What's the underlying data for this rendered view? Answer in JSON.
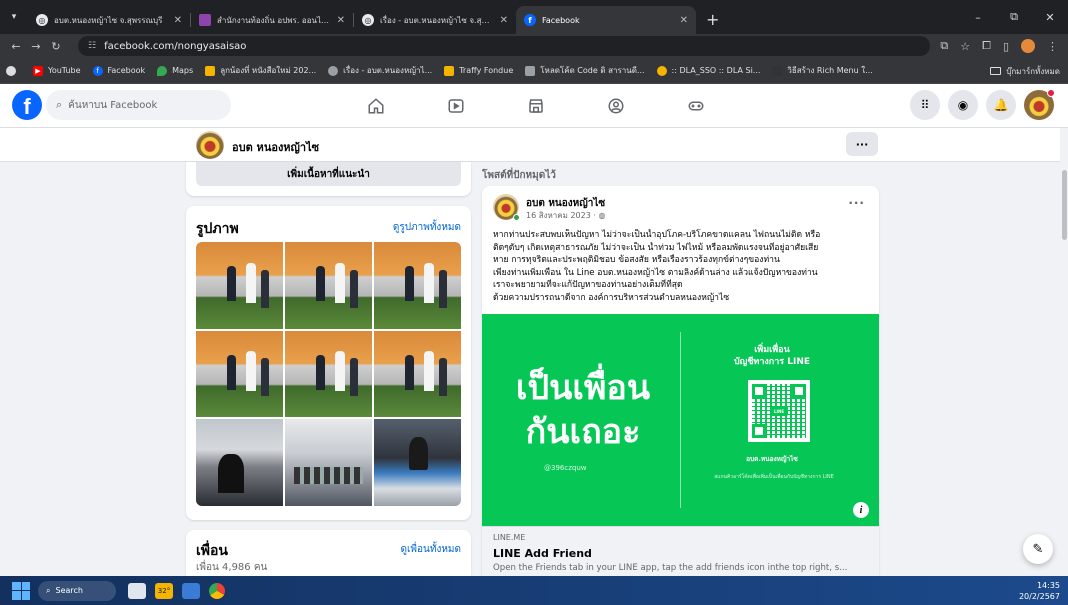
{
  "browser": {
    "tabs": [
      {
        "label": "อบต.หนองหญ้าไซ  จ.สุพรรณบุรี",
        "fav_color": "#e8eaed",
        "active": false
      },
      {
        "label": "สำนักงานท้องถิ่น อปพร. ออนไลน์",
        "fav_color": "#8e44ad",
        "active": false
      },
      {
        "label": "เรื่อง - อบต.หนองหญ้าไซ จ.สุพรรณบ",
        "fav_color": "#e8eaed",
        "active": false
      },
      {
        "label": "Facebook",
        "fav_color": "#0866ff",
        "active": true
      }
    ],
    "new_tab": "+",
    "window_controls": [
      "–",
      "⧉",
      "✕"
    ],
    "url": "facebook.com/nongyasaisao"
  },
  "bookmarks": {
    "items": [
      {
        "label": "YouTube",
        "color": "#ff0000"
      },
      {
        "label": "Facebook",
        "color": "#0866ff"
      },
      {
        "label": "Maps",
        "color": "#34a853"
      },
      {
        "label": "ลูกน้องที่ หนังสือใหม่ 202...",
        "color": "#f4b400"
      },
      {
        "label": "เรื่อง - อบต.หนองหญ้าไ...",
        "color": "#9aa0a6"
      },
      {
        "label": "Traffy Fondue",
        "color": "#f4b400"
      },
      {
        "label": "โหลดโค้ด Code ดิ สารานดี...",
        "color": "#9aa0a6"
      },
      {
        "label": ":: DLA_SSO :: DLA Si...",
        "color": "#f4b400"
      },
      {
        "label": "วิธีสร้าง Rich Menu ใ...",
        "color": "#333333"
      }
    ],
    "all_bookmarks": "บุ๊กมาร์กทั้งหมด"
  },
  "facebook": {
    "logo": "f",
    "search_placeholder": "ค้นหาบน Facebook",
    "page_name": "อบต หนองหญ้าไซ",
    "more": "···"
  },
  "left": {
    "suggestions_button": "เพิ่มเนื้อหาที่แนะนำ",
    "photos_title": "รูปภาพ",
    "photos_link": "ดูรูปภาพทั้งหมด",
    "friends_title": "เพื่อน",
    "friends_link": "ดูเพื่อนทั้งหมด",
    "friends_count": "เพื่อน 4,986 คน"
  },
  "post": {
    "pinned_label": "โพสต์ที่ปักหมุดไว้",
    "author": "อบต หนองหญ้าไซ",
    "date": "16 สิงหาคม 2023 · ",
    "more": "···",
    "lines": [
      "หากท่านประสบพบเห็นปัญหา ไม่ว่าจะเป็นน้ำอุปโภค-บริโภคขาดแคลน ไฟถนนไม่ติด หรือ",
      "ติดๆดับๆ เกิดเหตุสาธารณภัย ไม่ว่าจะเป็น น้ำท่วม ไฟไหม้ หรือลมพัดแรงจนที่อยู่อาศัยเสีย",
      "หาย การทุจริตและประพฤติมิชอบ ข้อสงสัย หรือเรื่องราวร้องทุกข์ต่างๆของท่าน",
      "เพียงท่านเพิ่มเพื่อน ใน Line อบต.หนองหญ้าไซ ตามลิงค์ด้านล่าง แล้วแจ้งปัญหาของท่าน",
      "เราจะพยายามที่จะแก้ปัญหาของท่านอย่างเต็มที่ที่สุด",
      "ด้วยความปรารถนาดีจาก องค์การบริหารส่วนตำบลหนองหญ้าไซ"
    ],
    "image": {
      "big_line1": "เป็นเพื่อน",
      "big_line2": "กันเถอะ",
      "handle": "@396czquw",
      "add_title1": "เพิ่มเพื่อน",
      "add_title2": "บัญชีทางการ LINE",
      "qr_badge": "LINE",
      "qr_name": "อบต.หนองหญ้าไซ",
      "note": "สแกนคิวอาร์โค้ดเพื่อเพิ่มเป็นเพื่อนกับบัญชีทางการ LINE",
      "info": "i"
    },
    "link": {
      "domain": "LINE.ME",
      "title": "LINE Add Friend",
      "description": "Open the Friends tab in your LINE app, tap the add friends icon inthe top right, s..."
    }
  },
  "taskbar": {
    "search": "Search",
    "time": "14:35",
    "date": "20/2/2567",
    "weather": "32°"
  },
  "colors": {
    "facebook_blue": "#0866ff",
    "line_green": "#06c755"
  }
}
